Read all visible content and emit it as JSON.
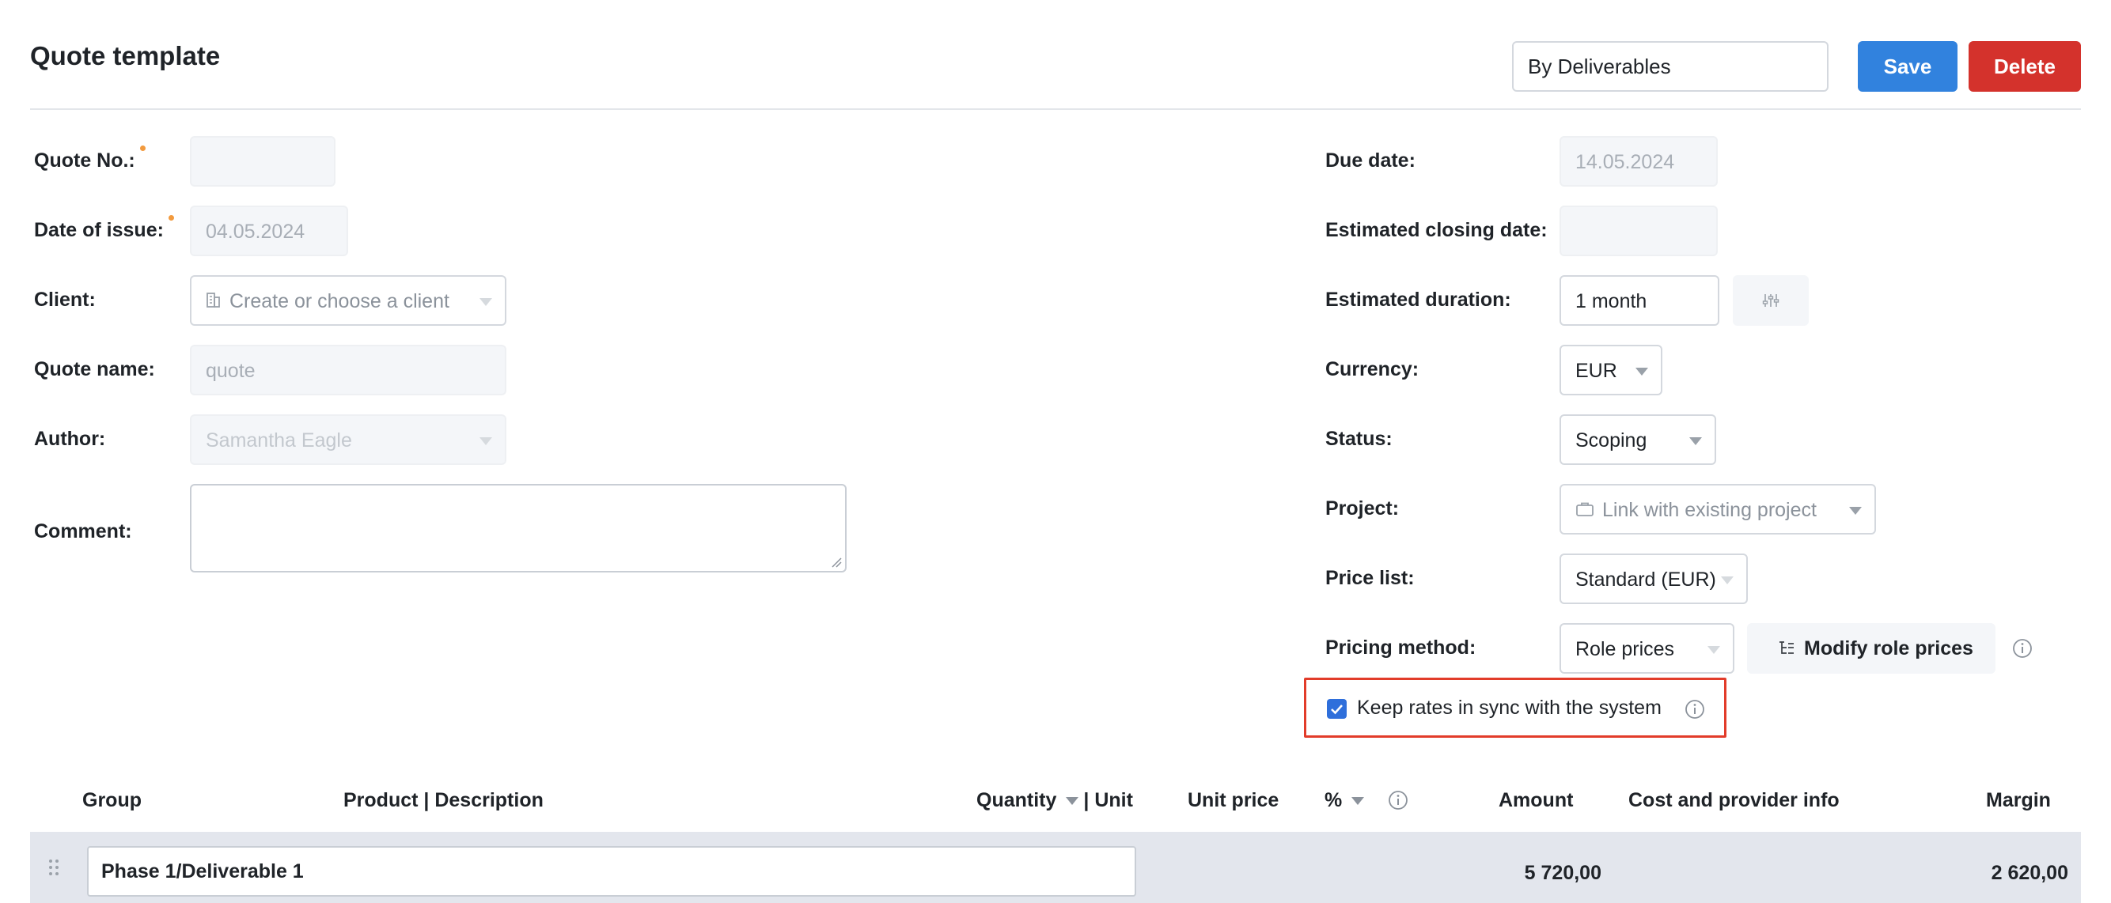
{
  "header": {
    "title": "Quote template",
    "template_select": "By Deliverables",
    "save_label": "Save",
    "delete_label": "Delete"
  },
  "left_form": {
    "quote_no": {
      "label": "Quote No.:",
      "value": ""
    },
    "date_of_issue": {
      "label": "Date of issue:",
      "value": "04.05.2024"
    },
    "client": {
      "label": "Client:",
      "placeholder": "Create or choose a client"
    },
    "quote_name": {
      "label": "Quote name:",
      "value": "quote"
    },
    "author": {
      "label": "Author:",
      "value": "Samantha Eagle"
    },
    "comment": {
      "label": "Comment:",
      "value": ""
    }
  },
  "right_form": {
    "due_date": {
      "label": "Due date:",
      "value": "14.05.2024"
    },
    "estimated_closing_date": {
      "label": "Estimated closing date:",
      "value": ""
    },
    "estimated_duration": {
      "label": "Estimated duration:",
      "value": "1 month"
    },
    "currency": {
      "label": "Currency:",
      "value": "EUR"
    },
    "status": {
      "label": "Status:",
      "value": "Scoping"
    },
    "project": {
      "label": "Project:",
      "placeholder": "Link with existing project"
    },
    "price_list": {
      "label": "Price list:",
      "value": "Standard (EUR)"
    },
    "pricing_method": {
      "label": "Pricing method:",
      "value": "Role prices",
      "modify_label": "Modify role prices"
    },
    "sync": {
      "label": "Keep rates in sync with the system",
      "checked": true
    }
  },
  "table": {
    "headers": {
      "group": "Group",
      "product_description": "Product | Description",
      "quantity": "Quantity",
      "unit": "| Unit",
      "unit_price": "Unit price",
      "percent": "%",
      "amount": "Amount",
      "cost_provider": "Cost and provider info",
      "margin": "Margin"
    },
    "rows": [
      {
        "name": "Phase 1/Deliverable 1",
        "amount": "5 720,00",
        "margin": "2 620,00"
      }
    ]
  },
  "colors": {
    "primary": "#3182de",
    "danger": "#d4322c",
    "highlight_border": "#e23c2a",
    "required_dot": "#f29a3e"
  },
  "icons": [
    "building-icon",
    "briefcase-icon",
    "sliders-icon",
    "info-icon",
    "hierarchy-icon",
    "drag-handle-icon",
    "chevron-down-icon"
  ]
}
